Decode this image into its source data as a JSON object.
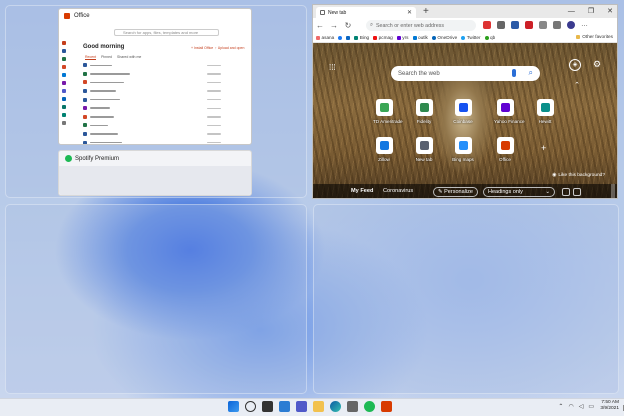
{
  "office": {
    "title": "Office",
    "search_placeholder": "Search for apps, files, templates and more",
    "greeting": "Good morning",
    "install_label": "+ Install Office",
    "upload_label": "↑ Upload and open",
    "tabs": [
      {
        "label": "Recent",
        "active": true
      },
      {
        "label": "Pinned"
      },
      {
        "label": "Shared with me"
      }
    ]
  },
  "spotify": {
    "title": "Spotify Premium"
  },
  "edge": {
    "tab_title": "New tab",
    "address_placeholder": "Search or enter web address",
    "favorites": [
      "asana",
      "Bing",
      "pcmag",
      "yrs",
      "outlk",
      "OneDrive",
      "Twitter",
      "qb"
    ],
    "other_favorites": "Other favorites",
    "ntp_search_placeholder": "Search the web",
    "tiles": [
      {
        "label": "TD Ameritrade",
        "color": "#3aa655"
      },
      {
        "label": "Fidelity",
        "color": "#2f8a4e"
      },
      {
        "label": "Coinbase",
        "color": "#1652f0"
      },
      {
        "label": "Yahoo Finance",
        "color": "#6001d2"
      },
      {
        "label": "Hewitt",
        "color": "#0a8f8a"
      },
      {
        "label": "Zillow",
        "color": "#1277e1"
      },
      {
        "label": "New tab",
        "color": "#5a6170"
      },
      {
        "label": "Bing maps",
        "color": "#258ffa"
      },
      {
        "label": "Office",
        "color": "#d83b01"
      }
    ],
    "like_bg": "Like this background?",
    "feed": {
      "my_feed": "My Feed",
      "coronavirus": "Coronavirus",
      "personalize": "Personalize",
      "headings_only": "Headings only"
    }
  },
  "clock": {
    "time": "7:50 AM",
    "date": "3/9/2021"
  }
}
